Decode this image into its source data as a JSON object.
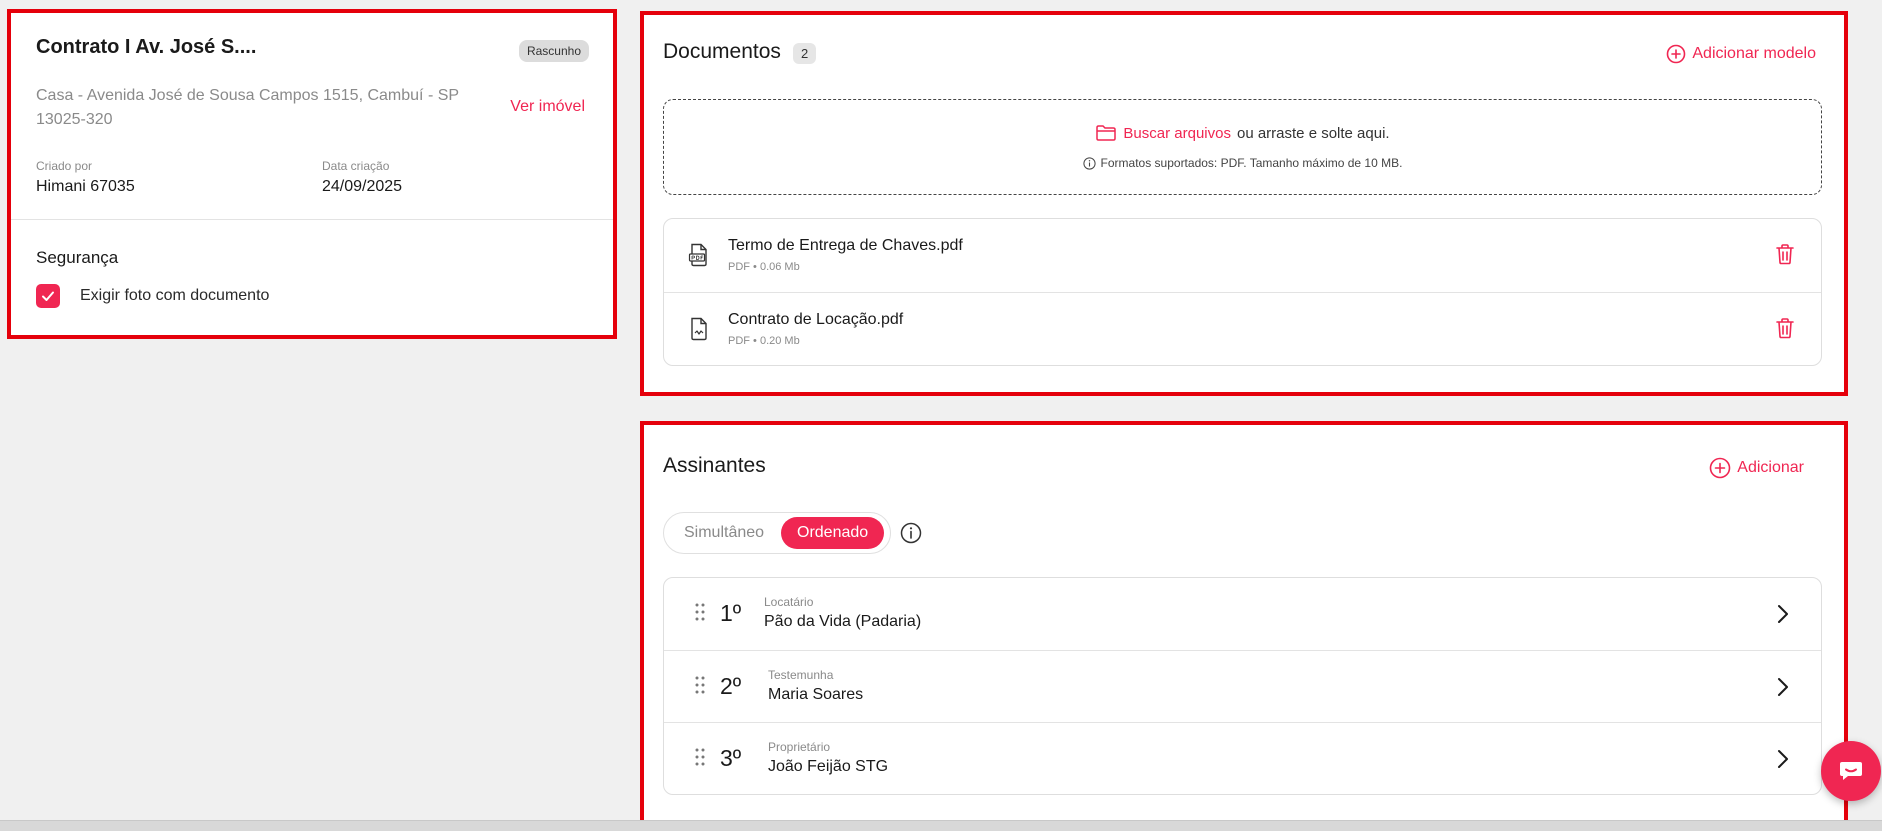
{
  "contract": {
    "title": "Contrato I Av. José S....",
    "status_badge": "Rascunho",
    "address": "Casa - Avenida José de Sousa Campos 1515, Cambuí - SP 13025-320",
    "view_property_link": "Ver imóvel",
    "created_by_label": "Criado por",
    "created_by_value": "Himani 67035",
    "created_date_label": "Data criação",
    "created_date_value": "24/09/2025",
    "security_title": "Segurança",
    "require_photo_label": "Exigir foto com documento",
    "require_photo_checked": true
  },
  "documents": {
    "title": "Documentos",
    "count": "2",
    "add_template_label": "Adicionar modelo",
    "dropzone": {
      "browse_label": "Buscar arquivos",
      "drag_text": "ou arraste e solte aqui.",
      "info_text": "Formatos suportados: PDF. Tamanho máximo de 10 MB."
    },
    "files": [
      {
        "name": "Termo de Entrega de Chaves.pdf",
        "meta": "PDF • 0.06 Mb",
        "icon": "pdf-file-icon"
      },
      {
        "name": "Contrato de Locação.pdf",
        "meta": "PDF • 0.20 Mb",
        "icon": "file-signature-icon"
      }
    ]
  },
  "signers": {
    "title": "Assinantes",
    "add_label": "Adicionar",
    "mode_simultaneous": "Simultâneo",
    "mode_ordered": "Ordenado",
    "active_mode": "Ordenado",
    "list": [
      {
        "order": "1º",
        "role": "Locatário",
        "name": "Pão da Vida (Padaria)"
      },
      {
        "order": "2º",
        "role": "Testemunha",
        "name": "Maria Soares"
      },
      {
        "order": "3º",
        "role": "Proprietário",
        "name": "João Feijão STG"
      }
    ]
  },
  "colors": {
    "accent": "#f02652",
    "highlight_frame": "#e5000b",
    "background": "#f0f0f0"
  }
}
